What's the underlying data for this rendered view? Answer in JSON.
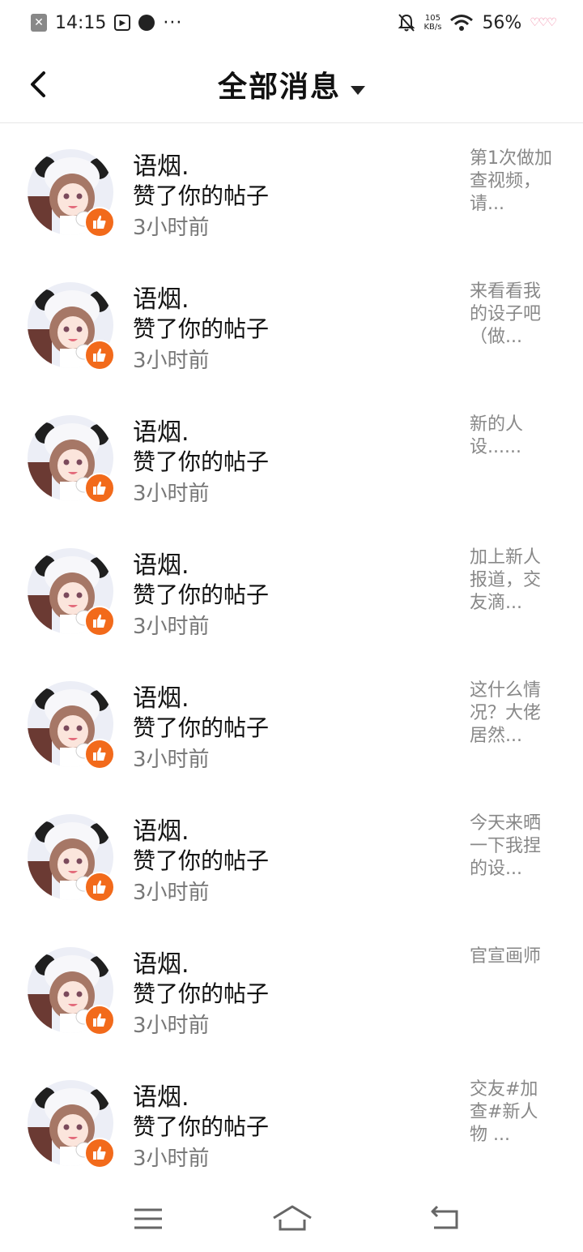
{
  "status_bar": {
    "time": "14:15",
    "net_speed_value": "105",
    "net_speed_unit": "KB/s",
    "battery": "56%",
    "more": "···"
  },
  "header": {
    "title": "全部消息"
  },
  "colors": {
    "like_badge": "#f26a1b",
    "divider": "#e6e6e6",
    "secondary_text": "#777777",
    "preview_text": "#888888"
  },
  "messages": [
    {
      "name": "语烟.",
      "action": "赞了你的帖子",
      "time": "3小时前",
      "preview": "第1次做加查视频，请..."
    },
    {
      "name": "语烟.",
      "action": "赞了你的帖子",
      "time": "3小时前",
      "preview": "来看看我的设子吧（做..."
    },
    {
      "name": "语烟.",
      "action": "赞了你的帖子",
      "time": "3小时前",
      "preview": "新的人设......"
    },
    {
      "name": "语烟.",
      "action": "赞了你的帖子",
      "time": "3小时前",
      "preview": "加上新人报道，交友滴..."
    },
    {
      "name": "语烟.",
      "action": "赞了你的帖子",
      "time": "3小时前",
      "preview": "这什么情况？大佬居然..."
    },
    {
      "name": "语烟.",
      "action": "赞了你的帖子",
      "time": "3小时前",
      "preview": "今天来晒一下我捏的设..."
    },
    {
      "name": "语烟.",
      "action": "赞了你的帖子",
      "time": "3小时前",
      "preview": "官宣画师"
    },
    {
      "name": "语烟.",
      "action": "赞了你的帖子",
      "time": "3小时前",
      "preview": "交友#加查#新人物 ..."
    }
  ],
  "icons": {
    "back": "chevron-left-icon",
    "dropdown": "caret-down-icon",
    "like": "thumbs-up-icon",
    "nav_menu": "menu-icon",
    "nav_home": "home-icon",
    "nav_back": "back-arrow-icon"
  }
}
